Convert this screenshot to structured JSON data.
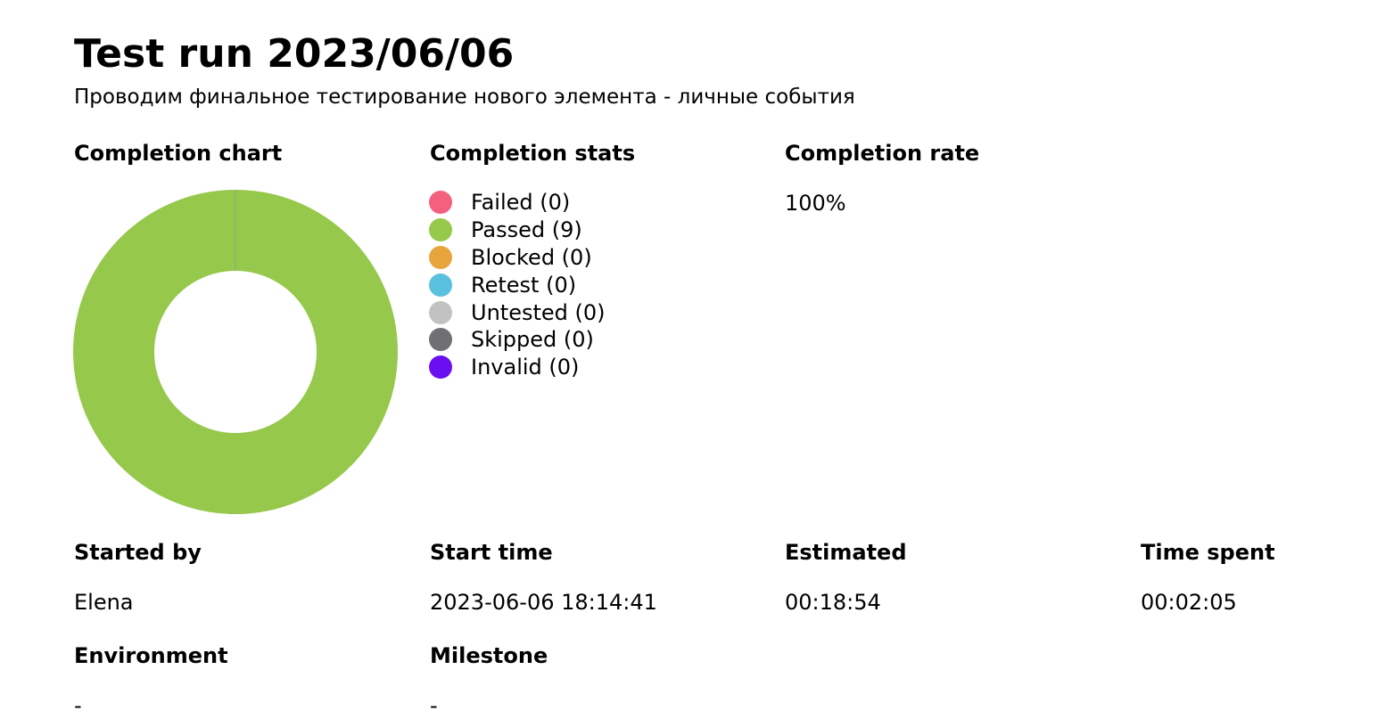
{
  "title": "Test run 2023/06/06",
  "description": "Проводим финальное тестирование нового элемента - личные события",
  "completion_chart": {
    "heading": "Completion chart"
  },
  "completion_stats": {
    "heading": "Completion stats",
    "items": [
      {
        "label": "Failed (0)",
        "status": "Failed",
        "count": 0,
        "color": "#f4617f"
      },
      {
        "label": "Passed (9)",
        "status": "Passed",
        "count": 9,
        "color": "#96c84c"
      },
      {
        "label": "Blocked (0)",
        "status": "Blocked",
        "count": 0,
        "color": "#e8a53d"
      },
      {
        "label": "Retest (0)",
        "status": "Retest",
        "count": 0,
        "color": "#5bc0de"
      },
      {
        "label": "Untested (0)",
        "status": "Untested",
        "count": 0,
        "color": "#c2c2c2"
      },
      {
        "label": "Skipped (0)",
        "status": "Skipped",
        "count": 0,
        "color": "#707074"
      },
      {
        "label": "Invalid (0)",
        "status": "Invalid",
        "count": 0,
        "color": "#6a0ff0"
      }
    ]
  },
  "completion_rate": {
    "heading": "Completion rate",
    "value": "100%"
  },
  "info": {
    "started_by_label": "Started by",
    "started_by_value": "Elena",
    "start_time_label": "Start time",
    "start_time_value": "2023-06-06 18:14:41",
    "estimated_label": "Estimated",
    "estimated_value": "00:18:54",
    "time_spent_label": "Time spent",
    "time_spent_value": "00:02:05",
    "environment_label": "Environment",
    "environment_value": "-",
    "milestone_label": "Milestone",
    "milestone_value": "-"
  },
  "chart_data": {
    "type": "pie",
    "variant": "donut",
    "categories": [
      "Failed",
      "Passed",
      "Blocked",
      "Retest",
      "Untested",
      "Skipped",
      "Invalid"
    ],
    "values": [
      0,
      9,
      0,
      0,
      0,
      0,
      0
    ],
    "colors": [
      "#f4617f",
      "#96c84c",
      "#e8a53d",
      "#5bc0de",
      "#c2c2c2",
      "#707074",
      "#6a0ff0"
    ],
    "title": "Completion chart",
    "legend": "right"
  }
}
